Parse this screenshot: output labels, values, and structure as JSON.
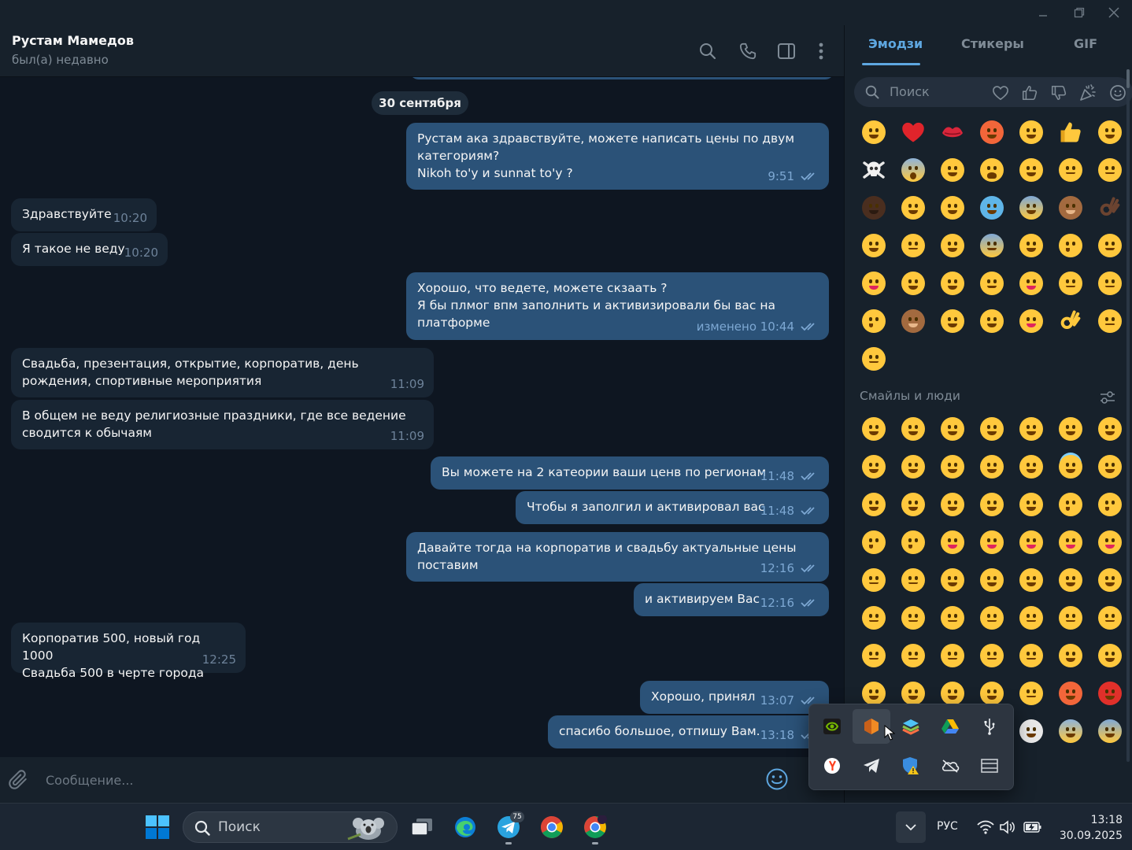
{
  "chat": {
    "name": "Рустам Мамедов",
    "status": "был(а) недавно",
    "date": "30 сентября"
  },
  "messages": [
    {
      "dir": "out",
      "text": "Рустам ака здравствуйте, можете написать цены по двум категориям?\nNikoh to'y и sunnat to'y ?",
      "time": "9:51"
    },
    {
      "dir": "in",
      "text": "Здравствуйте",
      "time": "10:20"
    },
    {
      "dir": "in",
      "text": "Я такое не веду",
      "time": "10:20"
    },
    {
      "dir": "out",
      "text": "Хорошо, что ведете, можете скзаать ?\nЯ бы плмог впм заполнить и активизировали бы вас на платформе",
      "time": "изменено 10:44"
    },
    {
      "dir": "in",
      "text": "Свадьба, презентация, открытие, корпоратив, день рождения, спортивные мероприятия",
      "time": "11:09"
    },
    {
      "dir": "in",
      "text": "В общем не веду религиозные праздники, где все ведение сводится к обычаям",
      "time": "11:09"
    },
    {
      "dir": "out",
      "text": "Вы можете на 2 катеории ваши ценв по  регионам",
      "time": "11:48"
    },
    {
      "dir": "out",
      "text": "Чтобы я заполгил и активировал вас",
      "time": "11:48"
    },
    {
      "dir": "out",
      "text": "Давайте тогда на корпоратив и свадьбу актуальные цены поставим",
      "time": "12:16"
    },
    {
      "dir": "out",
      "text": "и активируем Вас",
      "time": "12:16"
    },
    {
      "dir": "in",
      "text": "Корпоратив 500, новый год 1000\nСвадьба 500 в черте города",
      "time": "12:25"
    },
    {
      "dir": "out",
      "text": "Хорошо, принял",
      "time": "13:07"
    },
    {
      "dir": "out",
      "text": "спасибо большое, отпишу Вам.",
      "time": "13:18"
    }
  ],
  "composer": {
    "placeholder": "Сообщение..."
  },
  "emoji_panel": {
    "tabs": [
      "Эмодзи",
      "Стикеры",
      "GIF"
    ],
    "active_tab": "Эмодзи",
    "search_placeholder": "Поиск",
    "section_label": "Смайлы и люди"
  },
  "taskbar": {
    "search_placeholder": "Поиск",
    "telegram_badge": "75",
    "language": "РУС",
    "time": "13:18",
    "date": "30.09.2025"
  },
  "colors": {
    "accent": "#5ea7e0",
    "outgoing_bubble": "#2b5278",
    "incoming_bubble": "#182533",
    "background": "#0e1621",
    "panel": "#17212b"
  }
}
